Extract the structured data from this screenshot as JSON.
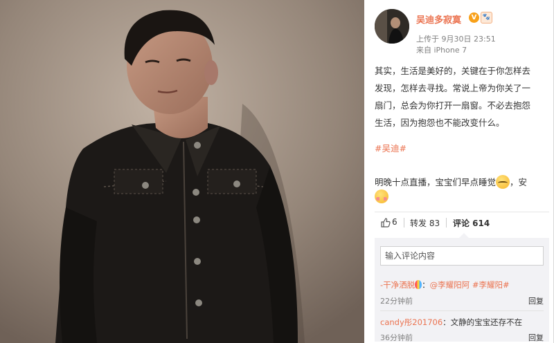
{
  "post": {
    "username": "吴迪多寂寞",
    "verified_badge": "V",
    "vip_badge": "🐾",
    "upload_time": "上传于 9月30日 23:51",
    "source": "来自 iPhone 7",
    "text_lines": [
      "其实，生活是美好的，关键在于你怎样去",
      "发现，怎样去寻找。常说上帝为你关了一",
      "扇门，总会为你打开一扇窗。不必去抱怨",
      "生活，因为抱怨也不能改变什么。"
    ],
    "hashtag": "#吴迪#",
    "second_text_a": "明晚十点直播，宝宝们早点睡觉",
    "second_text_b": "，安"
  },
  "actions": {
    "like_count": "6",
    "forward_label": "转发 83",
    "comment_label": "评论 614"
  },
  "comment_box": {
    "placeholder": "输入评论内容"
  },
  "comments": [
    {
      "user": "-干净洒脱",
      "text_mention": "@李耀阳阿",
      "text_tag": "#李耀阳#",
      "time": "22分钟前",
      "reply": "回复"
    },
    {
      "user": "candy彤201706",
      "text": "：文静的宝宝还存不在",
      "time": "36分钟前",
      "reply": "回复"
    }
  ],
  "colors": {
    "accent": "#eb7350",
    "meta": "#808080",
    "comment_bg": "#f2f2f5"
  },
  "icons": {
    "like": "thumbs-up-icon",
    "balloon": "balloon-emoji-icon",
    "sleep": "sleepy-face-emoji-icon",
    "shy": "blushing-face-emoji-icon"
  }
}
